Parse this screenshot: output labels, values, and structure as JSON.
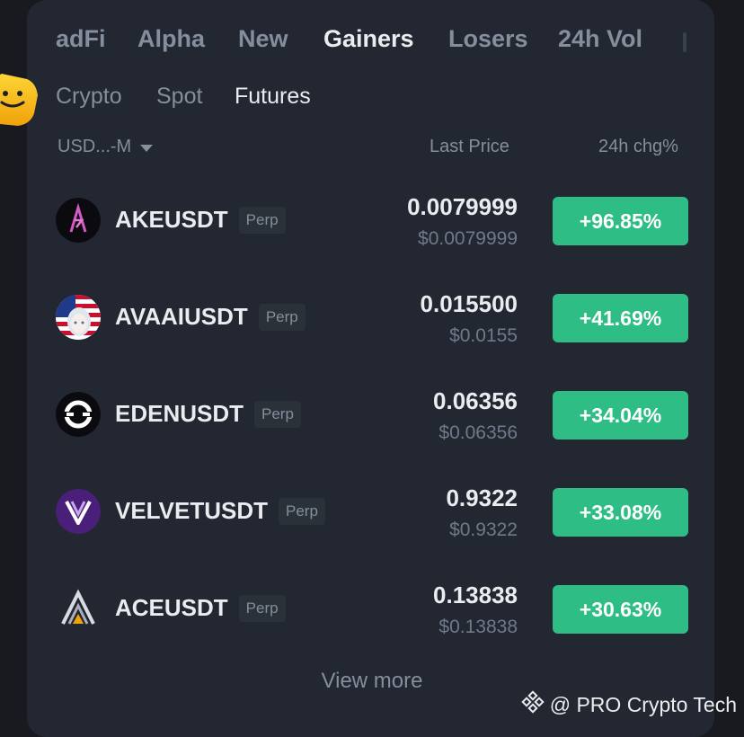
{
  "tabs": [
    {
      "label": "adFi",
      "active": false
    },
    {
      "label": "Alpha",
      "active": false
    },
    {
      "label": "New",
      "active": false
    },
    {
      "label": "Gainers",
      "active": true
    },
    {
      "label": "Losers",
      "active": false
    },
    {
      "label": "24h Vol",
      "active": false
    }
  ],
  "subtabs": [
    {
      "label": "Crypto",
      "active": false
    },
    {
      "label": "Spot",
      "active": false
    },
    {
      "label": "Futures",
      "active": true
    }
  ],
  "filter": {
    "label": "USD...-M"
  },
  "columns": {
    "last_price": "Last Price",
    "change": "24h chg%"
  },
  "rows": [
    {
      "symbol": "AKEUSDT",
      "badge": "Perp",
      "price": "0.0079999",
      "fiat": "$0.0079999",
      "change": "+96.85%",
      "icon": "ake-logo-icon"
    },
    {
      "symbol": "AVAAIUSDT",
      "badge": "Perp",
      "price": "0.015500",
      "fiat": "$0.0155",
      "change": "+41.69%",
      "icon": "avaai-logo-icon"
    },
    {
      "symbol": "EDENUSDT",
      "badge": "Perp",
      "price": "0.06356",
      "fiat": "$0.06356",
      "change": "+34.04%",
      "icon": "eden-logo-icon"
    },
    {
      "symbol": "VELVETUSDT",
      "badge": "Perp",
      "price": "0.9322",
      "fiat": "$0.9322",
      "change": "+33.08%",
      "icon": "velvet-logo-icon"
    },
    {
      "symbol": "ACEUSDT",
      "badge": "Perp",
      "price": "0.13838",
      "fiat": "$0.13838",
      "change": "+30.63%",
      "icon": "ace-logo-icon"
    }
  ],
  "view_more": "View more",
  "watermark": "@ PRO Crypto Tech",
  "colors": {
    "gain": "#2ebd85",
    "panel": "#222731",
    "background": "#181a20",
    "muted": "#848e9c"
  }
}
